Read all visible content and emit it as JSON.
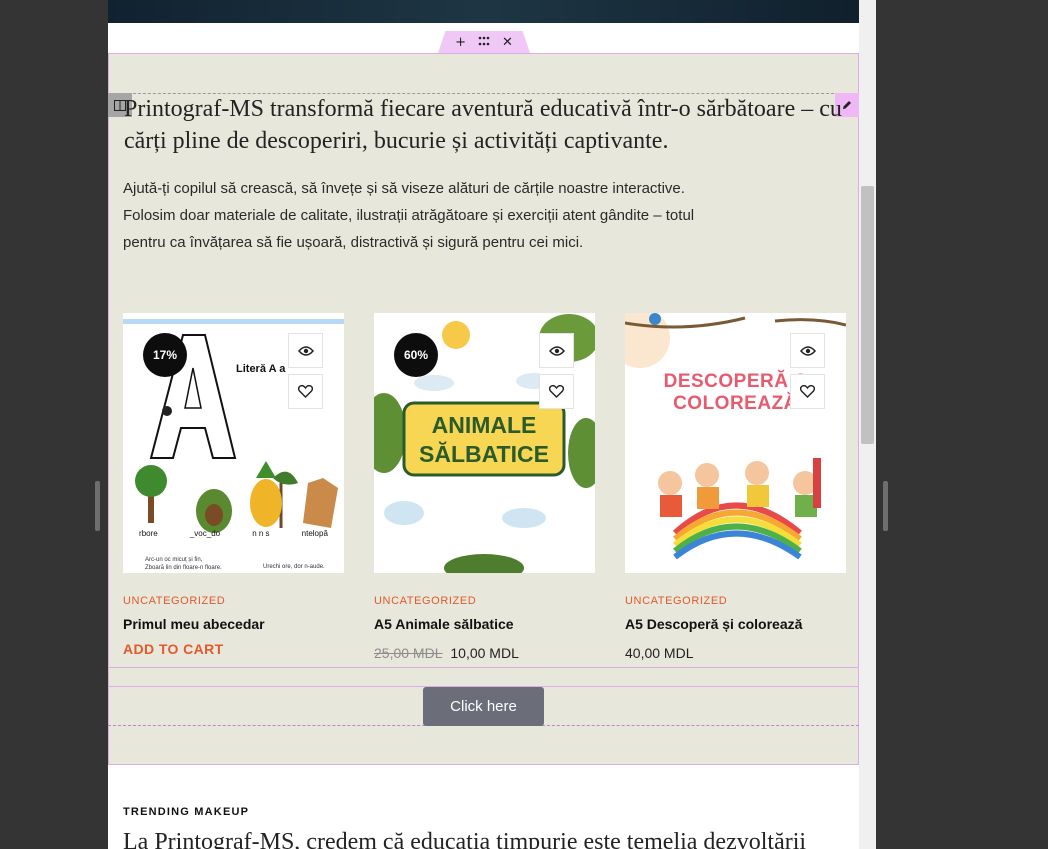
{
  "toolbar": {
    "add_icon": "+",
    "move_icon": "⋮⋮",
    "close_icon": "✕"
  },
  "intro": {
    "heading": "Printograf-MS transformă fiecare aventură educativă într-o sărbătoare – cu cărți pline de descoperiri, bucurie și activități captivante.",
    "paragraph": "Ajută-ți copilul să crească, să învețe și să viseze alături de cărțile noastre interactive. Folosim doar materiale de calitate, ilustrații atrăgătoare și exerciții atent gândite – totul pentru ca învățarea să fie ușoară, distractivă și sigură pentru cei mici."
  },
  "products": [
    {
      "badge": "17%",
      "category": "UNCATEGORIZED",
      "title": "Primul meu abecedar",
      "cart_label": "ADD TO CART",
      "img": {
        "heading": "Literă A a",
        "words": [
          "rbore",
          "_voc_do",
          "n n s",
          "ntelopă"
        ],
        "line1": "Arc-un oc micuț și fin,",
        "line2": "Zboară lin din floare-n floare.",
        "line3": "Urechi ore, dor n-aude."
      }
    },
    {
      "badge": "60%",
      "category": "UNCATEGORIZED",
      "title": "A5 Animale sălbatice",
      "old_price": "25,00 MDL",
      "price": "10,00 MDL",
      "img": {
        "line1": "ANIMALE",
        "line2": "SĂLBATICE"
      }
    },
    {
      "category": "UNCATEGORIZED",
      "title": "A5 Descoperă și colorează",
      "price": "40,00 MDL",
      "img": {
        "line1": "DESCOPERĂ Ș",
        "line2": "COLOREAZĂ"
      }
    }
  ],
  "cta": {
    "label": "Click here"
  },
  "trending": {
    "eyebrow": "TRENDING MAKEUP",
    "heading": "La Printograf-MS, credem că educația timpurie este temelia dezvoltării"
  },
  "colors": {
    "accent": "#e05a2b",
    "section_bg": "#e8e7db",
    "button_bg": "#6b6e78",
    "editor_pink": "#efb7f5"
  },
  "icons": [
    "plus-icon",
    "drag-icon",
    "close-icon",
    "column-icon",
    "pencil-icon",
    "eye-icon",
    "heart-icon"
  ]
}
